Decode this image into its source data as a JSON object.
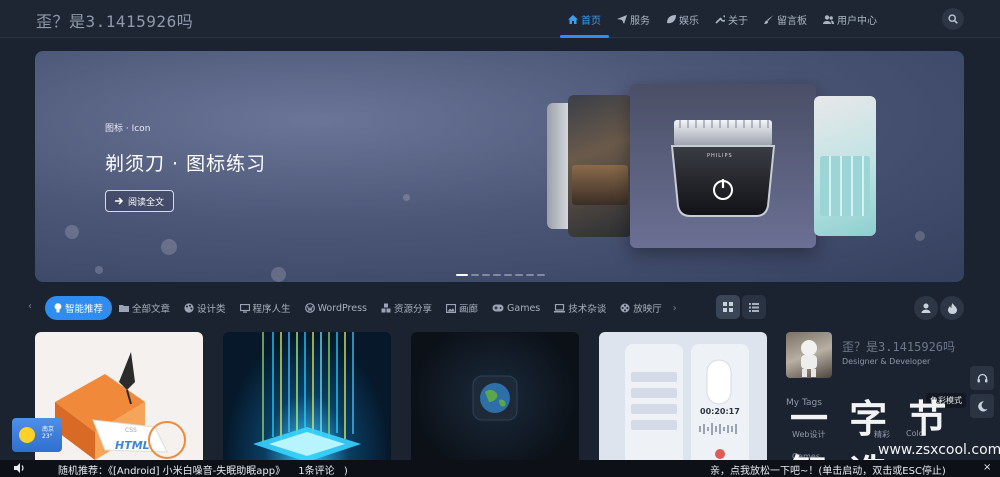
{
  "header": {
    "site_title": "歪？是3.1415926吗",
    "nav": [
      {
        "label": "首页",
        "icon": "home-icon",
        "active": true
      },
      {
        "label": "服务",
        "icon": "plane-icon",
        "active": false
      },
      {
        "label": "娱乐",
        "icon": "leaf-icon",
        "active": false
      },
      {
        "label": "关于",
        "icon": "wrench-icon",
        "active": false
      },
      {
        "label": "留言板",
        "icon": "paint-brush-icon",
        "active": false
      },
      {
        "label": "用户中心",
        "icon": "users-icon",
        "active": false
      }
    ],
    "search_icon": "search-icon"
  },
  "hero": {
    "category": "图标 · Icon",
    "title": "剃须刀 · 图标练习",
    "read_label": "阅读全文",
    "center_card_brand": "PHILIPS",
    "slides_count": 8,
    "active_slide": 0
  },
  "categories": {
    "tabs": [
      {
        "label": "智能推荐",
        "icon": "bulb-icon",
        "active": true
      },
      {
        "label": "全部文章",
        "icon": "folder-icon",
        "active": false
      },
      {
        "label": "设计类",
        "icon": "palette-icon",
        "active": false
      },
      {
        "label": "程序人生",
        "icon": "monitor-icon",
        "active": false
      },
      {
        "label": "WordPress",
        "icon": "wordpress-icon",
        "active": false
      },
      {
        "label": "资源分享",
        "icon": "cubes-icon",
        "active": false
      },
      {
        "label": "画廊",
        "icon": "image-icon",
        "active": false
      },
      {
        "label": "Games",
        "icon": "gamepad-icon",
        "active": false
      },
      {
        "label": "技术杂谈",
        "icon": "laptop-icon",
        "active": false
      },
      {
        "label": "放映厅",
        "icon": "film-icon",
        "active": false
      }
    ],
    "view_modes": [
      "grid-icon",
      "list-icon"
    ]
  },
  "posts": [
    {
      "thumb_text": "HTML",
      "thumb_label": "CSS"
    },
    {
      "thumb_text": ""
    },
    {
      "thumb_text": ""
    },
    {
      "thumb_text": "00:20:17"
    }
  ],
  "author": {
    "name": "歪？是3.1415926吗",
    "role": "Designer & Developer",
    "tags_title": "My Tags",
    "tags": [
      "Web设计",
      "精彩",
      "Colo",
      "Games"
    ]
  },
  "float_tools": {
    "tooltip": "色彩模式"
  },
  "weather": {
    "city": "南京",
    "temp": "23°"
  },
  "bottom_bar": {
    "random_prefix": "随机推荐：",
    "random_title": "《[Android] 小米白噪音-失眠助眠app》",
    "comment_count": "1条评论",
    "right_text": "亲，点我放松一下吧~！(单击启动，双击或ESC停止)",
    "close": "×"
  },
  "watermark": {
    "text": "一 字 节 智 造",
    "url": "www.zsxcool.com"
  },
  "colors": {
    "accent": "#2f8cf0",
    "background": "#1c2330",
    "header": "#1e2633"
  }
}
